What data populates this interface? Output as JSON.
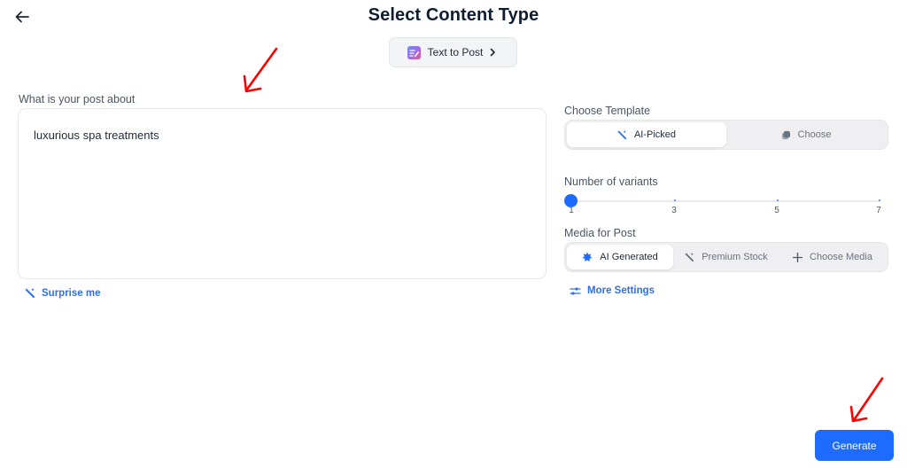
{
  "header": {
    "title": "Select Content Type",
    "back_icon": "arrow-left-icon"
  },
  "content_type": {
    "label": "Text to Post",
    "icon": "text-to-post-icon",
    "chevron_icon": "chevron-right-icon"
  },
  "post": {
    "label": "What is your post about",
    "value": "luxurious spa treatments",
    "surprise_label": "Surprise me",
    "surprise_icon": "magic-wand-icon"
  },
  "template": {
    "label": "Choose Template",
    "options": [
      {
        "label": "AI-Picked",
        "icon": "magic-wand-icon",
        "active": true
      },
      {
        "label": "Choose",
        "icon": "layers-icon",
        "active": false
      }
    ]
  },
  "variants": {
    "label": "Number of variants",
    "value": 1,
    "min": 1,
    "max": 7,
    "ticks": [
      "1",
      "3",
      "5",
      "7"
    ]
  },
  "media": {
    "label": "Media for Post",
    "options": [
      {
        "label": "AI Generated",
        "icon": "sparkle-icon",
        "active": true
      },
      {
        "label": "Premium Stock",
        "icon": "magic-wand-icon",
        "active": false
      },
      {
        "label": "Choose Media",
        "icon": "plus-icon",
        "active": false
      }
    ],
    "more_settings_label": "More Settings",
    "more_settings_icon": "sliders-icon"
  },
  "actions": {
    "generate_label": "Generate"
  },
  "colors": {
    "accent": "#1e6bff",
    "link": "#2f6fe8",
    "title": "#0f1d33",
    "annotation": "#ff0000"
  }
}
